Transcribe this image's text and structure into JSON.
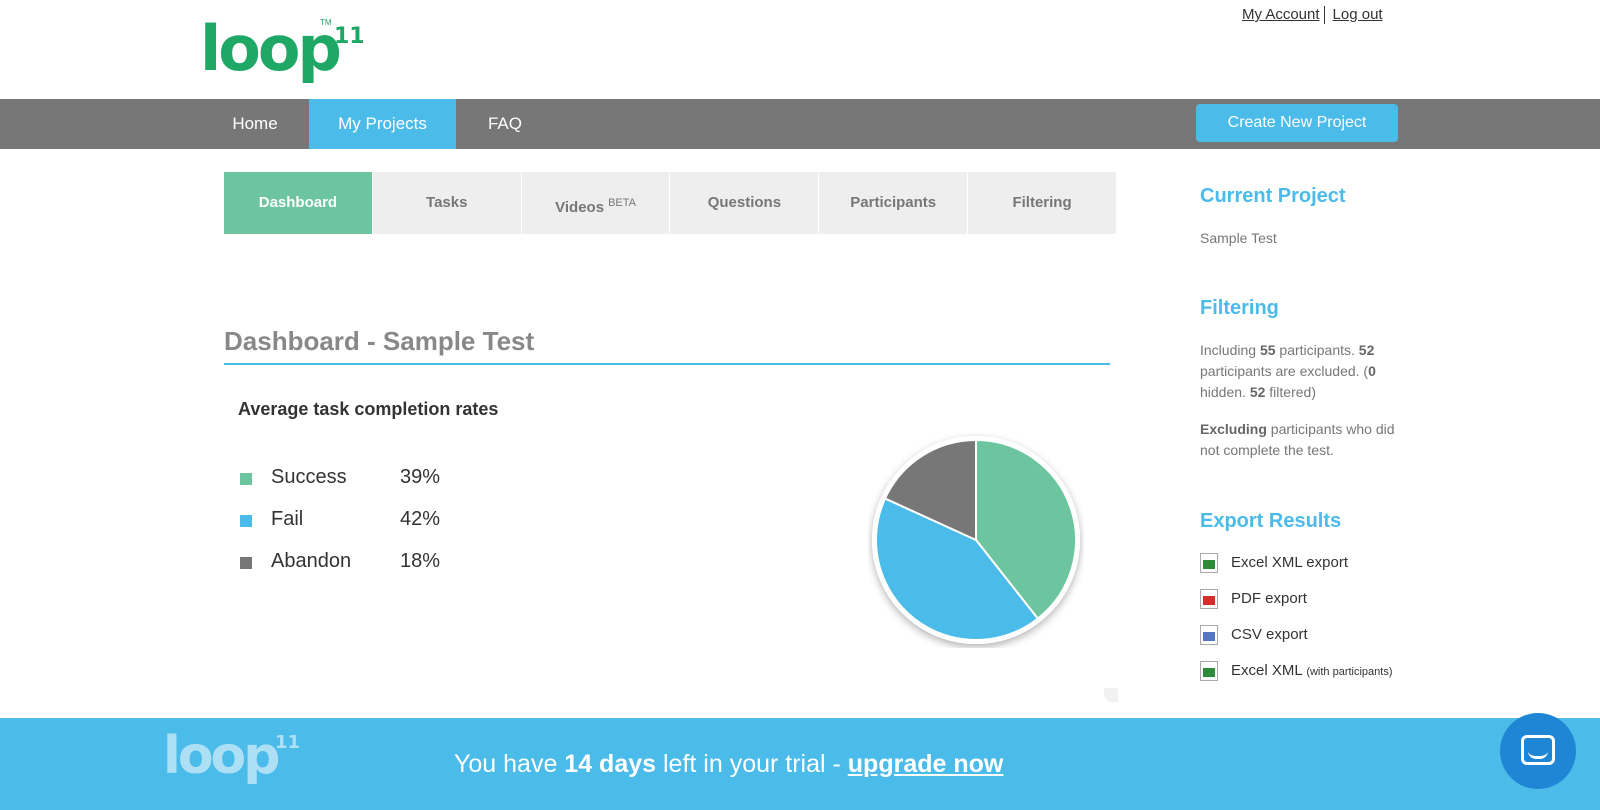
{
  "brand": {
    "logo_text": "loop",
    "logo_sup": "11",
    "logo_tm": "TM"
  },
  "account": {
    "my_account": "My Account",
    "logout": "Log out"
  },
  "nav": {
    "items": [
      {
        "label": "Home",
        "active": false
      },
      {
        "label": "My Projects",
        "active": true
      },
      {
        "label": "FAQ",
        "active": false
      }
    ],
    "create_button": "Create New Project"
  },
  "tabs": [
    {
      "label": "Dashboard",
      "sup": "",
      "active": true
    },
    {
      "label": "Tasks",
      "sup": "",
      "active": false
    },
    {
      "label": "Videos",
      "sup": "BETA",
      "active": false
    },
    {
      "label": "Questions",
      "sup": "",
      "active": false
    },
    {
      "label": "Participants",
      "sup": "",
      "active": false
    },
    {
      "label": "Filtering",
      "sup": "",
      "active": false
    }
  ],
  "main": {
    "title": "Dashboard - Sample Test",
    "section_heading": "Average task completion rates"
  },
  "chart_data": {
    "type": "pie",
    "title": "Average task completion rates",
    "categories": [
      "Success",
      "Fail",
      "Abandon"
    ],
    "values": [
      39,
      42,
      18
    ],
    "labels": [
      "39%",
      "42%",
      "18%"
    ],
    "colors": [
      "#6dc5a0",
      "#4bbbe9",
      "#777777"
    ],
    "legend_position": "left"
  },
  "sidebar": {
    "current_project": {
      "heading": "Current Project",
      "name": "Sample Test"
    },
    "filtering": {
      "heading": "Filtering",
      "line1_a": "Including ",
      "line1_included": "55",
      "line1_b": " participants. ",
      "line1_excluded": "52",
      "line1_c": " participants are excluded. (",
      "line1_hidden": "0",
      "line1_d": " hidden. ",
      "line1_filtered": "52",
      "line1_e": " filtered)",
      "line2_bold": "Excluding",
      "line2_rest": " participants who did not complete the test."
    },
    "export": {
      "heading": "Export Results",
      "items": [
        {
          "label": "Excel XML export",
          "small": "",
          "icon": "excel-icon",
          "color": "#2e8b3a"
        },
        {
          "label": "PDF export",
          "small": "",
          "icon": "pdf-icon",
          "color": "#d62c2c"
        },
        {
          "label": "CSV export",
          "small": "",
          "icon": "csv-icon",
          "color": "#5574c4"
        },
        {
          "label": "Excel XML ",
          "small": "(with participants)",
          "icon": "excel-icon",
          "color": "#2e8b3a"
        }
      ]
    }
  },
  "footer": {
    "logo_text": "loop",
    "logo_sup": "11",
    "msg_a": "You have ",
    "msg_days": "14 days",
    "msg_b": " left in your trial - ",
    "msg_link": "upgrade now"
  },
  "colors": {
    "accent_blue": "#4bbbe9",
    "accent_green": "#6dc5a0",
    "nav_gray": "#777777",
    "logo_green": "#1fa765"
  }
}
